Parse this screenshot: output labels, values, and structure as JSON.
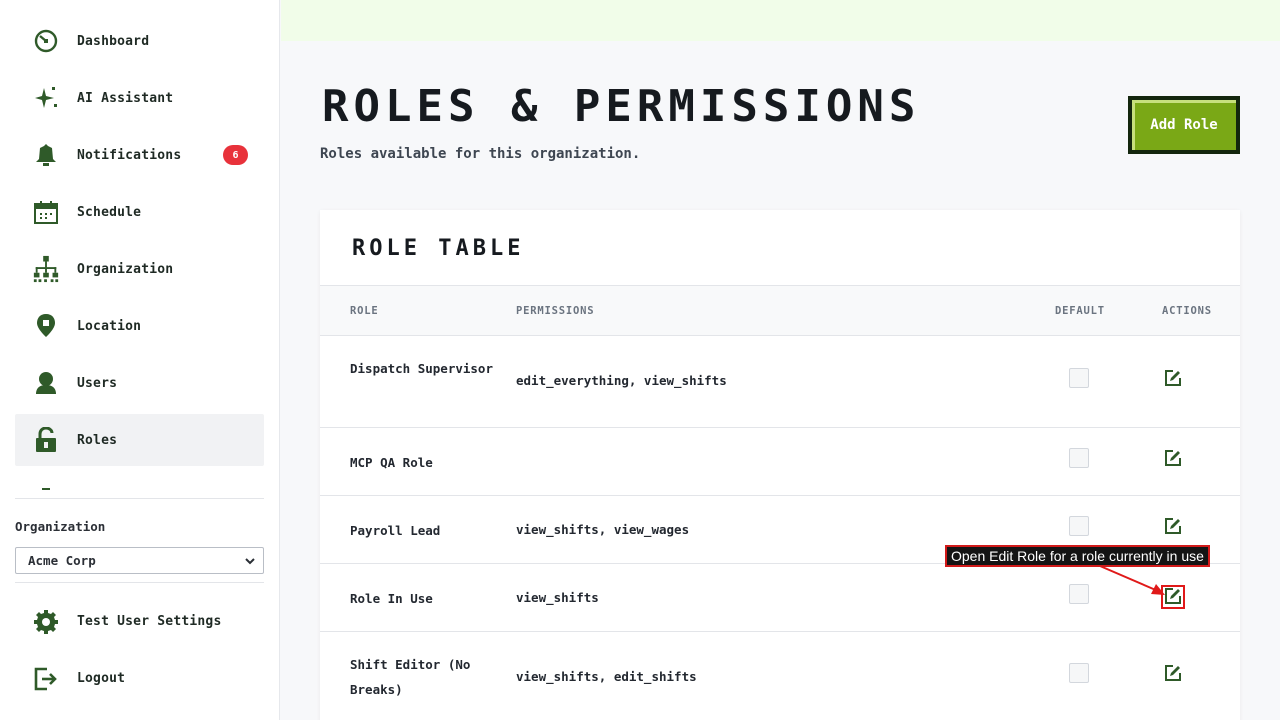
{
  "sidebar": {
    "items": [
      {
        "label": "Dashboard",
        "icon": "dashboard-icon"
      },
      {
        "label": "AI Assistant",
        "icon": "sparkle-icon"
      },
      {
        "label": "Notifications",
        "icon": "bell-icon",
        "badge": "6"
      },
      {
        "label": "Schedule",
        "icon": "calendar-icon"
      },
      {
        "label": "Organization",
        "icon": "org-chart-icon"
      },
      {
        "label": "Location",
        "icon": "location-pin-icon"
      },
      {
        "label": "Users",
        "icon": "user-icon"
      },
      {
        "label": "Roles",
        "icon": "unlock-icon",
        "active": true
      }
    ],
    "organization_label": "Organization",
    "organization_value": "Acme Corp",
    "footer": [
      {
        "label": "Test User Settings",
        "icon": "gear-icon"
      },
      {
        "label": "Logout",
        "icon": "logout-icon"
      }
    ]
  },
  "header": {
    "title": "Roles & Permissions",
    "subtitle": "Roles available for this organization.",
    "add_button": "Add Role"
  },
  "table": {
    "title": "Role Table",
    "columns": [
      "ROLE",
      "PERMISSIONS",
      "DEFAULT",
      "ACTIONS"
    ],
    "rows": [
      {
        "role": "Dispatch Supervisor",
        "permissions": "edit_everything, view_shifts",
        "default": false
      },
      {
        "role": "MCP QA Role",
        "permissions": "",
        "default": false
      },
      {
        "role": "Payroll Lead",
        "permissions": "view_shifts, view_wages",
        "default": false
      },
      {
        "role": "Role In Use",
        "permissions": "view_shifts",
        "default": false
      },
      {
        "role": "Shift Editor (No Breaks)",
        "permissions": "view_shifts, edit_shifts",
        "default": false
      }
    ]
  },
  "annotation": {
    "text": "Open Edit Role for a role currently in use"
  },
  "colors": {
    "accent": "#7aa816",
    "icon": "#2f5a29",
    "badge": "#e8323b",
    "annotation": "#d11a1a",
    "top_strip": "#f1fde9"
  }
}
